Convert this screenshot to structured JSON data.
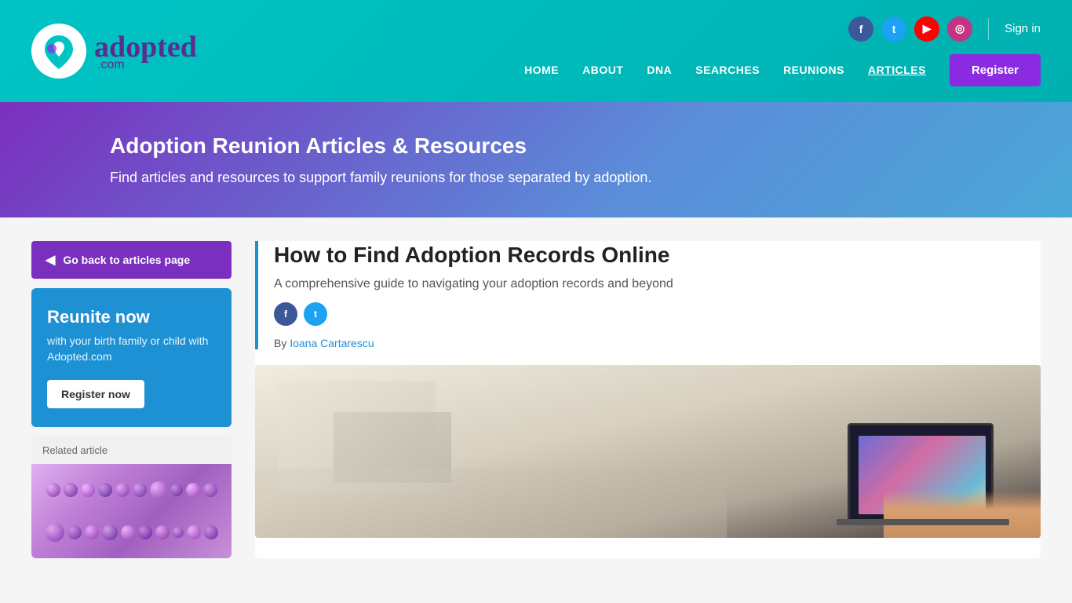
{
  "header": {
    "logo_text": "adopted",
    "logo_dotcom": ".com",
    "signin_label": "Sign in",
    "register_label": "Register",
    "nav_items": [
      {
        "id": "home",
        "label": "HOME"
      },
      {
        "id": "about",
        "label": "ABOUT"
      },
      {
        "id": "dna",
        "label": "DNA"
      },
      {
        "id": "searches",
        "label": "SEARCHES"
      },
      {
        "id": "reunions",
        "label": "REUNIONS"
      },
      {
        "id": "articles",
        "label": "ARTICLES"
      }
    ],
    "social_items": [
      {
        "id": "facebook",
        "label": "f"
      },
      {
        "id": "twitter",
        "label": "t"
      },
      {
        "id": "youtube",
        "label": "▶"
      },
      {
        "id": "instagram",
        "label": "◎"
      }
    ]
  },
  "hero": {
    "title": "Adoption Reunion Articles & Resources",
    "subtitle": "Find articles and resources to support family reunions for those separated by adoption."
  },
  "sidebar": {
    "back_button_label": "Go back to articles page",
    "reunite": {
      "title": "Reunite now",
      "subtitle": "with your birth family or child with Adopted.com",
      "register_label": "Register now"
    },
    "related_article": {
      "label": "Related article"
    }
  },
  "article": {
    "title": "How to Find Adoption Records Online",
    "subtitle": "A comprehensive guide to navigating your adoption records and beyond",
    "author_prefix": "By ",
    "author_name": "Ioana Cartarescu",
    "social_icons": [
      {
        "id": "facebook",
        "symbol": "f"
      },
      {
        "id": "twitter",
        "symbol": "t"
      }
    ]
  }
}
